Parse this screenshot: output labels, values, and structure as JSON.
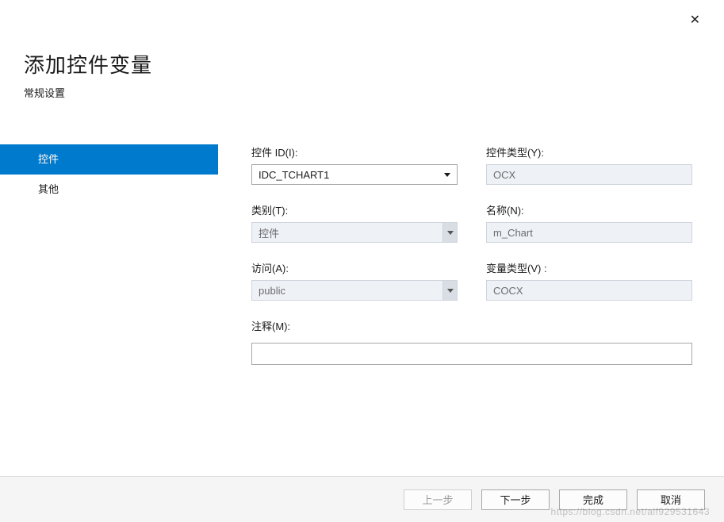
{
  "close_glyph": "✕",
  "header": {
    "title": "添加控件变量",
    "subtitle": "常规设置"
  },
  "sidebar": {
    "items": [
      {
        "label": "控件",
        "active": true
      },
      {
        "label": "其他",
        "active": false
      }
    ]
  },
  "form": {
    "control_id": {
      "label": "控件 ID(I):",
      "value": "IDC_TCHART1"
    },
    "control_type": {
      "label": "控件类型(Y):",
      "value": "OCX"
    },
    "category": {
      "label": "类别(T):",
      "value": "控件"
    },
    "name": {
      "label": "名称(N):",
      "value": "m_Chart"
    },
    "access": {
      "label": "访问(A):",
      "value": "public"
    },
    "var_type": {
      "label": "变量类型(V) :",
      "value": "COCX"
    },
    "comment": {
      "label": "注释(M):",
      "value": ""
    }
  },
  "footer": {
    "prev": "上一步",
    "next": "下一步",
    "finish": "完成",
    "cancel": "取消"
  },
  "watermark": "https://blog.csdn.net/alf929531643"
}
